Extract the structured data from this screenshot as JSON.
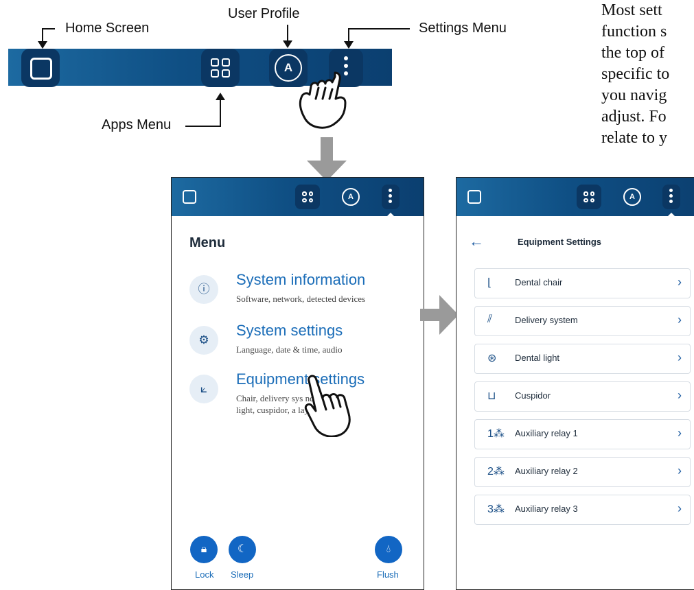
{
  "callouts": {
    "home_screen": "Home Screen",
    "user_profile": "User Profile",
    "settings_menu": "Settings Menu",
    "apps_menu": "Apps Menu"
  },
  "avatar_letter": "A",
  "paragraph_lines": [
    "Most sett",
    "function s",
    "the top of",
    "specific to",
    "you navig",
    "adjust. Fo",
    "relate to y"
  ],
  "menu_screen": {
    "title": "Menu",
    "items": [
      {
        "icon": "info-icon",
        "label": "System information",
        "sub1": "Software, network, detected devices",
        "sub2": ""
      },
      {
        "icon": "gear-icon",
        "label": "System settings",
        "sub1": "Language, date & time, audio",
        "sub2": ""
      },
      {
        "icon": "dental-chair-icon",
        "label": "Equipment settings",
        "sub1": "Chair, delivery sys   ndpieces,",
        "sub2": "light, cuspidor, a        lays"
      }
    ],
    "lock_label": "Lock",
    "sleep_label": "Sleep",
    "flush_label": "Flush"
  },
  "equipment_screen": {
    "title": "Equipment Settings",
    "rows": [
      {
        "icon": "dental-chair-icon",
        "label": "Dental chair"
      },
      {
        "icon": "delivery-system-icon",
        "label": "Delivery system"
      },
      {
        "icon": "dental-light-icon",
        "label": "Dental light"
      },
      {
        "icon": "cuspidor-icon",
        "label": "Cuspidor"
      },
      {
        "icon": "relay-1-icon",
        "label": "Auxiliary relay 1"
      },
      {
        "icon": "relay-2-icon",
        "label": "Auxiliary relay 2"
      },
      {
        "icon": "relay-3-icon",
        "label": "Auxiliary relay 3"
      }
    ]
  },
  "colors": {
    "bar_dark": "#0b3f70",
    "bar_light": "#1d6aa1",
    "accent_blue": "#1b6db8",
    "button_blue": "#1266c4"
  }
}
